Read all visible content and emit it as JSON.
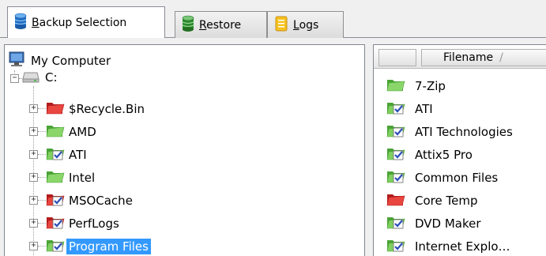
{
  "tabs": [
    {
      "label": "Backup Selection",
      "mnemonic": "B",
      "rest": "ackup Selection",
      "icon": "database-blue-icon"
    },
    {
      "label": "Restore",
      "mnemonic": "R",
      "rest": "estore",
      "icon": "database-green-icon"
    },
    {
      "label": "Logs",
      "mnemonic": "L",
      "rest": "ogs",
      "icon": "notepad-icon"
    }
  ],
  "tree": {
    "root": {
      "label": "My Computer",
      "icon": "computer-icon"
    },
    "drive": {
      "label": "C:",
      "icon": "drive-icon",
      "expander": "−"
    },
    "folders": [
      {
        "label": "$Recycle.Bin",
        "state": "excluded",
        "expander": "+"
      },
      {
        "label": "AMD",
        "state": "unchecked",
        "expander": "+"
      },
      {
        "label": "ATI",
        "state": "checked",
        "expander": "+"
      },
      {
        "label": "Intel",
        "state": "unchecked",
        "expander": "+"
      },
      {
        "label": "MSOCache",
        "state": "checked-red",
        "expander": "+"
      },
      {
        "label": "PerfLogs",
        "state": "checked-red",
        "expander": "+"
      },
      {
        "label": "Program Files",
        "state": "checked",
        "expander": "+",
        "selected": true
      }
    ]
  },
  "file_list": {
    "header": {
      "filename": "Filename",
      "sort_indicator": "/"
    },
    "rows": [
      {
        "name": "7-Zip",
        "state": "unchecked"
      },
      {
        "name": "ATI",
        "state": "checked"
      },
      {
        "name": "ATI Technologies",
        "state": "checked"
      },
      {
        "name": "Attix5 Pro",
        "state": "checked"
      },
      {
        "name": "Common Files",
        "state": "checked"
      },
      {
        "name": "Core Temp",
        "state": "excluded"
      },
      {
        "name": "DVD Maker",
        "state": "checked"
      },
      {
        "name": "Internet Explo…",
        "state": "checked"
      }
    ]
  },
  "colors": {
    "selection": "#3399ff",
    "folder_green": "#5cb838",
    "folder_red": "#d9262c",
    "check_blue": "#2b4eb8"
  }
}
